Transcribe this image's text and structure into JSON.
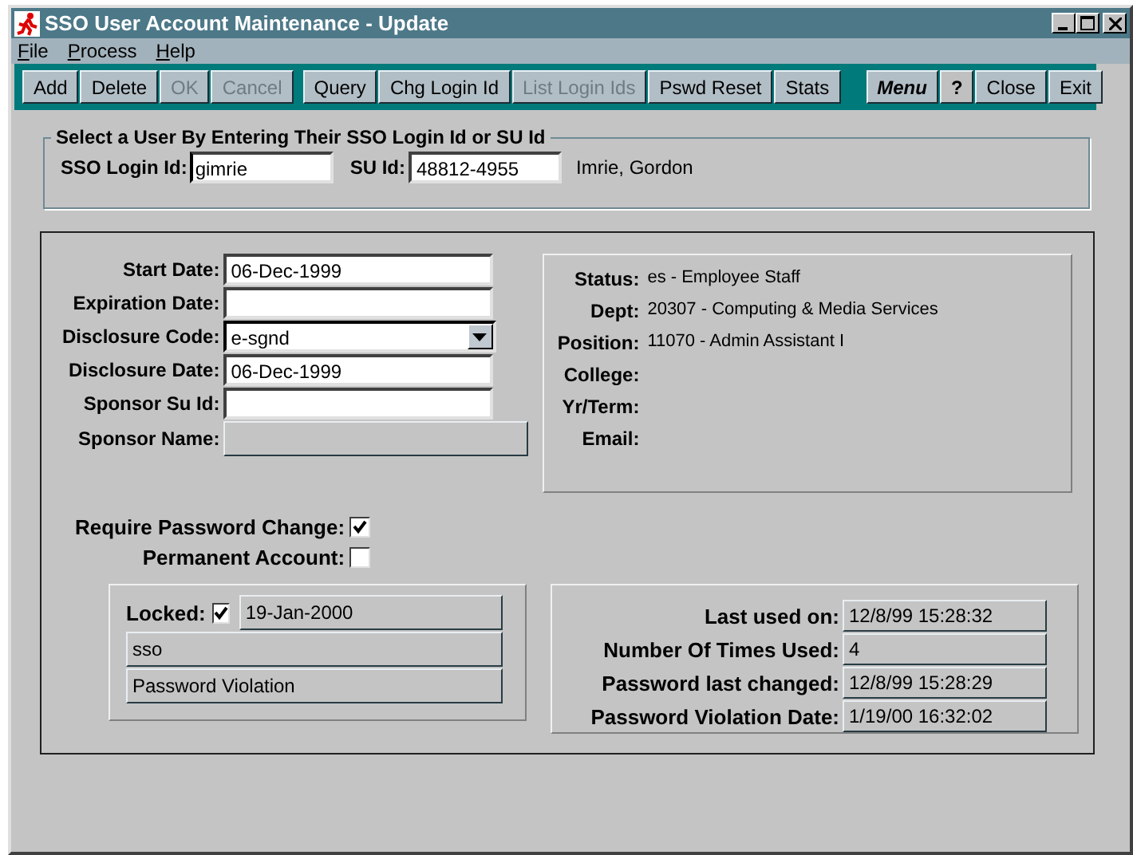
{
  "window": {
    "title": "SSO User Account Maintenance - Update"
  },
  "menu": [
    {
      "label": "File"
    },
    {
      "label": "Process"
    },
    {
      "label": "Help"
    }
  ],
  "toolbar_groups": [
    {
      "buttons": [
        {
          "label": "Add",
          "kind": "text",
          "disabled": false
        },
        {
          "label": "Delete",
          "kind": "text",
          "disabled": false
        },
        {
          "label": "OK",
          "kind": "text",
          "disabled": true
        },
        {
          "label": "Cancel",
          "kind": "text",
          "disabled": true
        }
      ]
    },
    {
      "buttons": [
        {
          "label": "Query",
          "kind": "text",
          "disabled": false
        },
        {
          "label": "Chg Login Id",
          "kind": "text",
          "disabled": false
        },
        {
          "label": "List Login Ids",
          "kind": "text",
          "disabled": true
        },
        {
          "label": "Pswd Reset",
          "kind": "text",
          "disabled": false
        },
        {
          "label": "Stats",
          "kind": "text",
          "disabled": false
        }
      ]
    },
    {
      "buttons": [
        {
          "label": "Menu",
          "kind": "menu",
          "disabled": false
        },
        {
          "label": "?",
          "kind": "help",
          "disabled": false
        },
        {
          "label": "Close",
          "kind": "text",
          "disabled": false
        },
        {
          "label": "Exit",
          "kind": "text",
          "disabled": false
        }
      ]
    }
  ],
  "lookup": {
    "legend": "Select a User By Entering Their SSO Login Id or SU Id",
    "login_id": {
      "label": "SSO Login Id:",
      "value": "gimrie"
    },
    "su_id": {
      "label": "SU Id:",
      "value": "48812-4955"
    },
    "name": "Imrie, Gordon"
  },
  "account_fields": [
    {
      "label": "Start Date:",
      "value": "06-Dec-1999",
      "kind": "input"
    },
    {
      "label": "Expiration Date:",
      "kind": "input"
    },
    {
      "label": "Disclosure Code:",
      "value": "e-sgnd",
      "kind": "dropdown"
    },
    {
      "label": "Disclosure Date:",
      "value": "06-Dec-1999",
      "kind": "input"
    },
    {
      "label": "Sponsor Su Id:",
      "kind": "input"
    },
    {
      "label": "Sponsor Name:",
      "kind": "readonly"
    }
  ],
  "info": [
    {
      "label": "Status:",
      "value": "es - Employee Staff"
    },
    {
      "label": "Dept:",
      "value": "20307 - Computing & Media Services"
    },
    {
      "label": "Position:",
      "value": "11070 - Admin Assistant I"
    },
    {
      "label": "College:"
    },
    {
      "label": "Yr/Term:"
    },
    {
      "label": "Email:"
    }
  ],
  "flags": [
    {
      "label": "Require Password Change:",
      "checked": true
    },
    {
      "label": "Permanent Account:",
      "checked": false
    }
  ],
  "lock": {
    "label": "Locked:",
    "checked": true,
    "date": "19-Jan-2000",
    "by": "sso",
    "reason": "Password Violation"
  },
  "usage": [
    {
      "label": "Last used on:",
      "value": "12/8/99 15:28:32"
    },
    {
      "label": "Number Of Times Used:",
      "value": "4"
    },
    {
      "label": "Password last changed:",
      "value": "12/8/99 15:28:29"
    },
    {
      "label": "Password Violation Date:",
      "value": "1/19/00 16:32:02"
    }
  ]
}
